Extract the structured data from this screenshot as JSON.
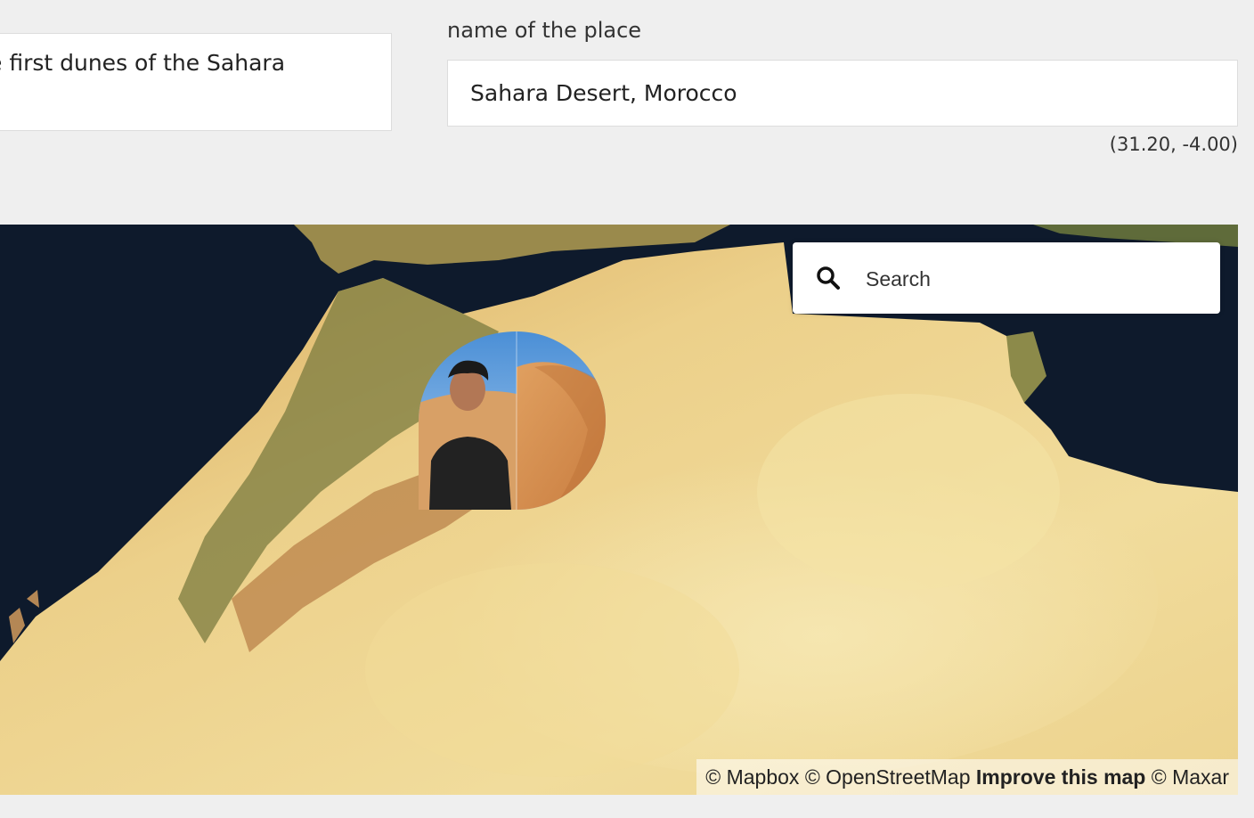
{
  "caption": {
    "text": "e first dunes of the Sahara"
  },
  "place": {
    "label": "name of the place",
    "value": "Sahara Desert, Morocco",
    "coordinates": "(31.20, -4.00)"
  },
  "map": {
    "search": {
      "placeholder": "Search",
      "icon": "search-icon"
    },
    "marker": {
      "icon": "photo-marker"
    },
    "attribution": {
      "mapbox": "© Mapbox",
      "osm": "© OpenStreetMap",
      "improve": "Improve this map",
      "maxar": "© Maxar"
    },
    "colors": {
      "sea": "#0e1a2c",
      "sand": "#ecd28c",
      "sand_light": "#f3e3a8",
      "terrain": "#c98e4b",
      "vegetation": "#6f7a3a"
    }
  }
}
